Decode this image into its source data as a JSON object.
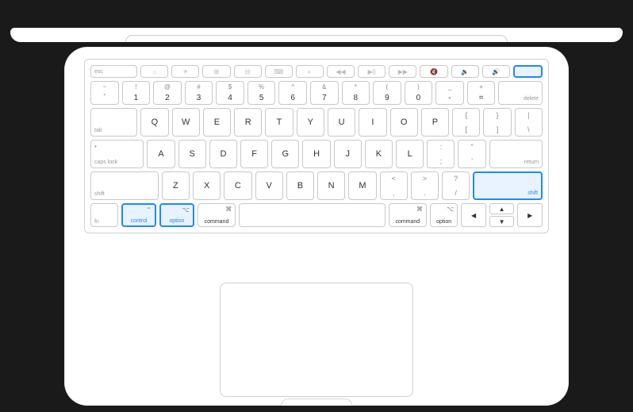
{
  "device": "macbook-keyboard-viewer",
  "highlighted_keys": [
    "power",
    "control-left",
    "option-left",
    "shift-right"
  ],
  "rows": {
    "fn": {
      "esc": "esc",
      "symbols": [
        "☼",
        "☀",
        "⊞",
        "⊟",
        "⌨",
        "◐",
        "◀◀",
        "▶||",
        "▶▶",
        "🔇",
        "🔉",
        "🔊"
      ]
    },
    "num": {
      "upper": [
        "~",
        "!",
        "@",
        "#",
        "$",
        "%",
        "^",
        "&",
        "*",
        "(",
        ")",
        "_",
        "+"
      ],
      "lower": [
        "`",
        "1",
        "2",
        "3",
        "4",
        "5",
        "6",
        "7",
        "8",
        "9",
        "0",
        "-",
        "="
      ],
      "delete": "delete"
    },
    "row_q": {
      "tab": "tab",
      "letters": [
        "Q",
        "W",
        "E",
        "R",
        "T",
        "Y",
        "U",
        "I",
        "O",
        "P"
      ],
      "br1_u": "{",
      "br1_d": "[",
      "br2_u": "}",
      "br2_d": "]",
      "bs_u": "|",
      "bs_d": "\\"
    },
    "row_a": {
      "caps": "caps lock",
      "letters": [
        "A",
        "S",
        "D",
        "F",
        "G",
        "H",
        "J",
        "K",
        "L"
      ],
      "sc_u": ":",
      "sc_d": ";",
      "qt_u": "\"",
      "qt_d": "'",
      "return": "return"
    },
    "row_z": {
      "shift_l": "shift",
      "letters": [
        "Z",
        "X",
        "C",
        "V",
        "B",
        "N",
        "M"
      ],
      "cm_u": "<",
      "cm_d": ",",
      "pd_u": ">",
      "pd_d": ".",
      "sl_u": "?",
      "sl_d": "/",
      "shift_r": "shift"
    },
    "bottom": {
      "fn": "fn",
      "control": "control",
      "control_sym": "⌃",
      "option": "option",
      "option_sym": "⌥",
      "command": "command",
      "command_sym": "⌘",
      "arrows": {
        "left": "◀",
        "up": "▲",
        "down": "▼",
        "right": "▶"
      }
    }
  }
}
